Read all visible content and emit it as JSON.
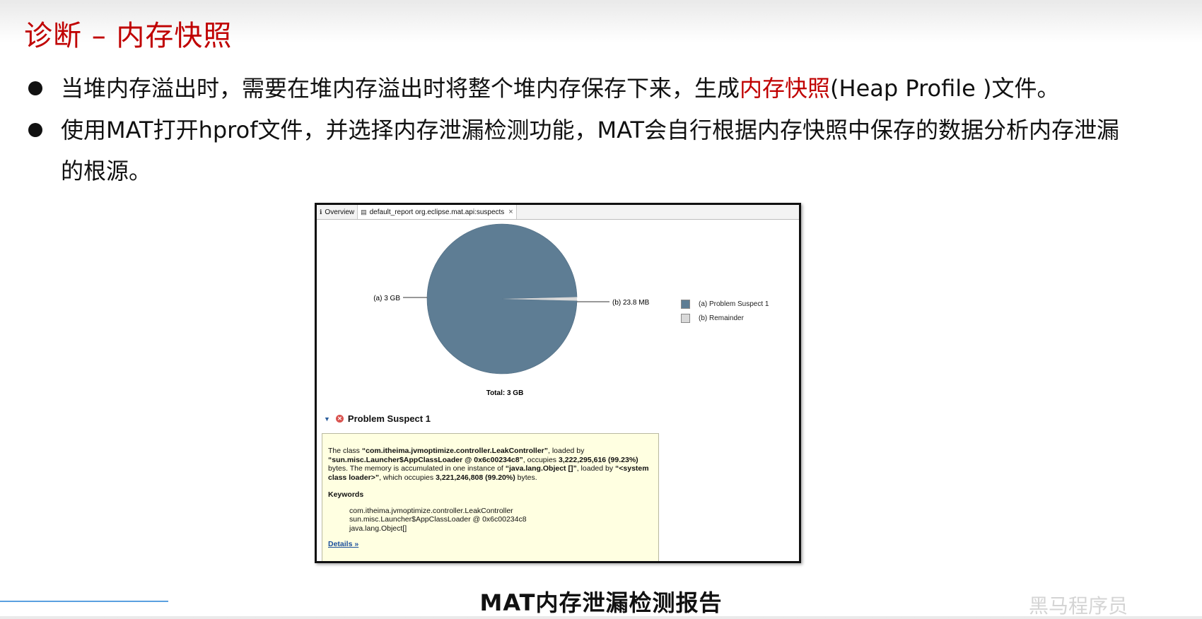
{
  "slide": {
    "title": "诊断 – 内存快照",
    "bullet1": {
      "pre": "当堆内存溢出时，需要在堆内存溢出时将整个堆内存保存下来，生成",
      "highlight": "内存快照",
      "post": "(Heap Profile )文件。"
    },
    "bullet2": "使用MAT打开hprof文件，并选择内存泄漏检测功能，MAT会自行根据内存快照中保存的数据分析内存泄漏的根源。",
    "caption": "MAT内存泄漏检测报告",
    "watermark": "黑马程序员"
  },
  "mat": {
    "tabs": [
      {
        "label": "Overview",
        "icon": "info-icon"
      },
      {
        "label": "default_report  org.eclipse.mat.api:suspects",
        "icon": "report-icon",
        "closable": true
      }
    ],
    "problem_title": "Problem Suspect 1",
    "description": {
      "p1": "The class ",
      "b1": "“com.itheima.jvmoptimize.controller.LeakController”",
      "p2": ", loaded by ",
      "b2": "“sun.misc.Launcher$AppClassLoader @ 0x6c00234c8”",
      "p3": ", occupies ",
      "b3": "3,222,295,616 (99.23%)",
      "p4": " bytes. The memory is accumulated in one instance of ",
      "b4": "“java.lang.Object []”",
      "p5": ", loaded by ",
      "b5": "“<system class loader>”",
      "p6": ", which occupies ",
      "b6": "3,221,246,808 (99.20%)",
      "p7": " bytes."
    },
    "keywords_title": "Keywords",
    "keywords": [
      "com.itheima.jvmoptimize.controller.LeakController",
      "sun.misc.Launcher$AppClassLoader @ 0x6c00234c8",
      "java.lang.Object[]"
    ],
    "details_link": "Details »"
  },
  "chart_data": {
    "type": "pie",
    "title": "",
    "total_label": "Total: 3 GB",
    "slices": [
      {
        "key": "a",
        "label": "(a)  3 GB",
        "legend": "(a)  Problem Suspect 1",
        "value_gb": 3.0,
        "percent": 99.23,
        "color": "#5e7d94"
      },
      {
        "key": "b",
        "label": "(b)  23.8 MB",
        "legend": "(b)  Remainder",
        "value_gb": 0.0232,
        "percent": 0.77,
        "color": "#d9d9d9"
      }
    ]
  }
}
